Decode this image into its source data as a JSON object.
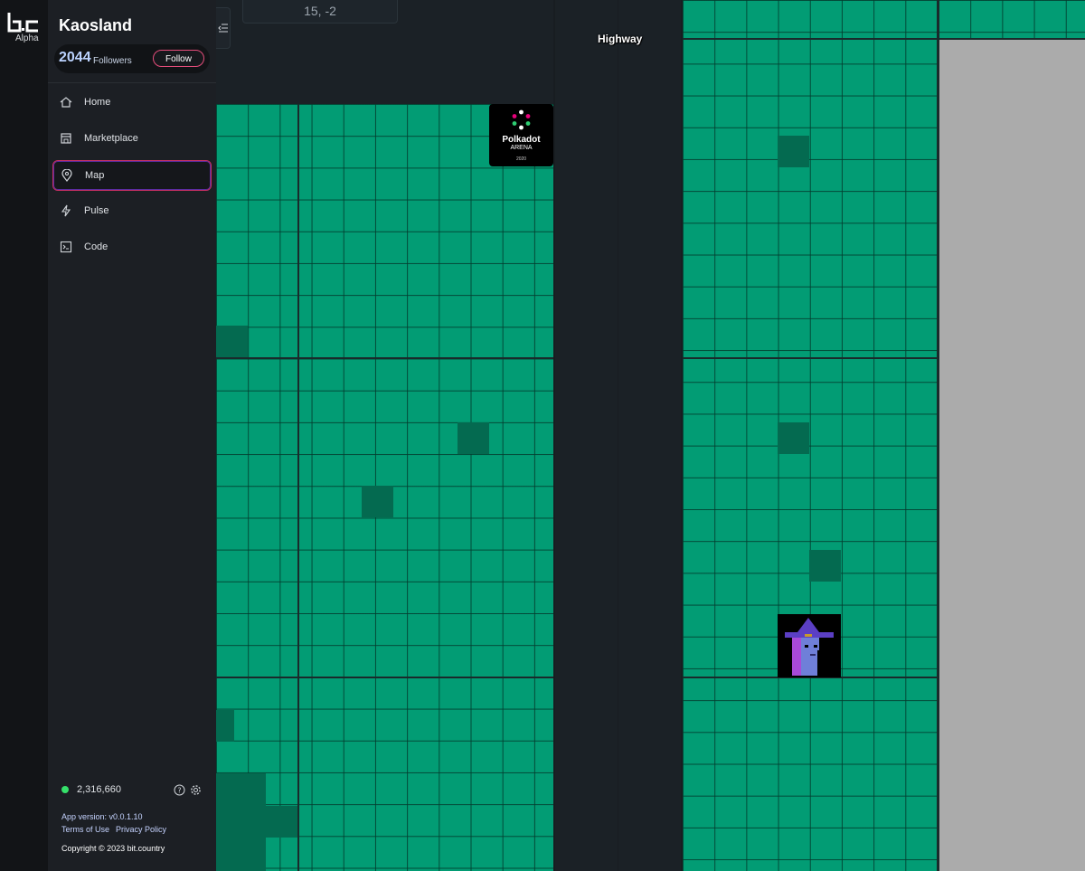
{
  "brand": {
    "logo_text": "b.c",
    "alpha_label": "Alpha"
  },
  "profile": {
    "title": "Kaosland",
    "followers_count": "2044",
    "followers_label": "Followers",
    "follow_label": "Follow"
  },
  "nav": {
    "items": [
      {
        "label": "Home",
        "icon": "home-icon",
        "active": false
      },
      {
        "label": "Marketplace",
        "icon": "store-icon",
        "active": false
      },
      {
        "label": "Map",
        "icon": "map-pin-icon",
        "active": true
      },
      {
        "label": "Pulse",
        "icon": "lightning-icon",
        "active": false
      },
      {
        "label": "Code",
        "icon": "terminal-icon",
        "active": false
      }
    ]
  },
  "footer": {
    "balance": "2,316,660",
    "app_version": "App version: v0.0.1.10",
    "terms": "Terms of Use",
    "privacy": "Privacy Policy",
    "copyright": "Copyright © 2023 bit.country"
  },
  "map": {
    "coordinates": "15, -2",
    "road_label": "Highway",
    "polkadot_tile": {
      "brand": "Polkadot",
      "subtitle": "ARENA",
      "year": "2020"
    }
  },
  "colors": {
    "plot_green": "#029c74",
    "owned_plot": "#046a50",
    "road": "#1b2126",
    "accent_pink": "#e64d7b",
    "status_green": "#35e06a"
  }
}
